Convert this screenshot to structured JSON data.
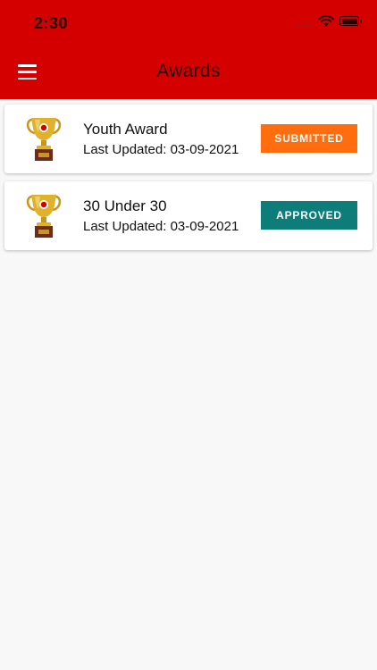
{
  "status_bar": {
    "time": "2:30"
  },
  "header": {
    "title": "Awards",
    "menu_icon": "hamburger-menu-icon"
  },
  "awards": [
    {
      "name": "Youth Award",
      "last_updated": "Last Updated: 03-09-2021",
      "status": "SUBMITTED",
      "status_color": "#ff6d0f",
      "icon": "trophy-icon"
    },
    {
      "name": "30 Under 30",
      "last_updated": "Last Updated: 03-09-2021",
      "status": "APPROVED",
      "status_color": "#0c7d79",
      "icon": "trophy-icon"
    }
  ],
  "colors": {
    "header_background": "#d40000",
    "page_background": "#f8f8f8"
  }
}
